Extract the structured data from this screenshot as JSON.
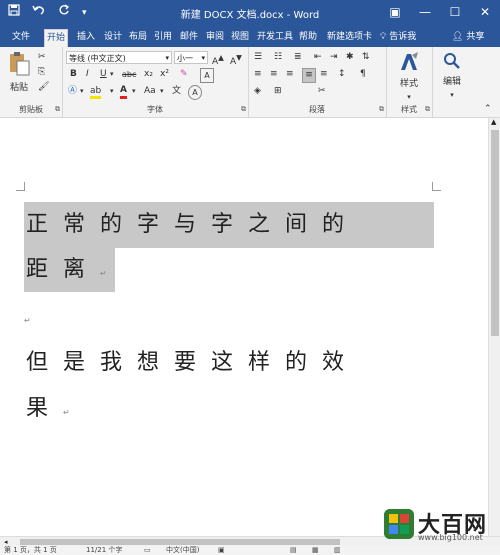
{
  "window": {
    "title": "新建 DOCX 文档.docx - Word",
    "qat_icons": [
      "save-icon",
      "undo-icon",
      "redo-icon",
      "customize-icon"
    ],
    "controls": [
      "restore-ribbon-icon",
      "minimize-icon",
      "maximize-icon",
      "close-icon"
    ],
    "min_glyph": "—",
    "max_glyph": "☐",
    "close_glyph": "✕",
    "restore_glyph": "▣"
  },
  "tabs": [
    "文件",
    "开始",
    "插入",
    "设计",
    "布局",
    "引用",
    "邮件",
    "审阅",
    "视图",
    "开发工具",
    "帮助",
    "新建选项卡"
  ],
  "active_tab": "开始",
  "tell_me": "告诉我",
  "share": "共享",
  "ribbon": {
    "clipboard": {
      "label": "剪贴板",
      "paste": "粘贴"
    },
    "font": {
      "label": "字体",
      "family": "等线 (中文正文)",
      "size": "小一",
      "buttons": [
        "B",
        "I",
        "U",
        "abc",
        "x₂",
        "x²",
        "A",
        "A",
        "Aa",
        "A"
      ]
    },
    "paragraph": {
      "label": "段落"
    },
    "styles": {
      "label": "样式",
      "button": "样式"
    },
    "editing": {
      "label": "",
      "button": "编辑"
    }
  },
  "document": {
    "para1": "正 常 的 字 与 字 之 间 的",
    "para1_line2": "距 离",
    "para2": "但 是 我 想 要 这 样 的 效",
    "para2_line2": "果",
    "para_mark": "↵"
  },
  "status": {
    "page": "第 1 页，共 1 页",
    "words": "11/21 个字",
    "lang": "中文(中国)"
  },
  "watermark": {
    "text": "大百网",
    "url": "www.big100.net"
  }
}
